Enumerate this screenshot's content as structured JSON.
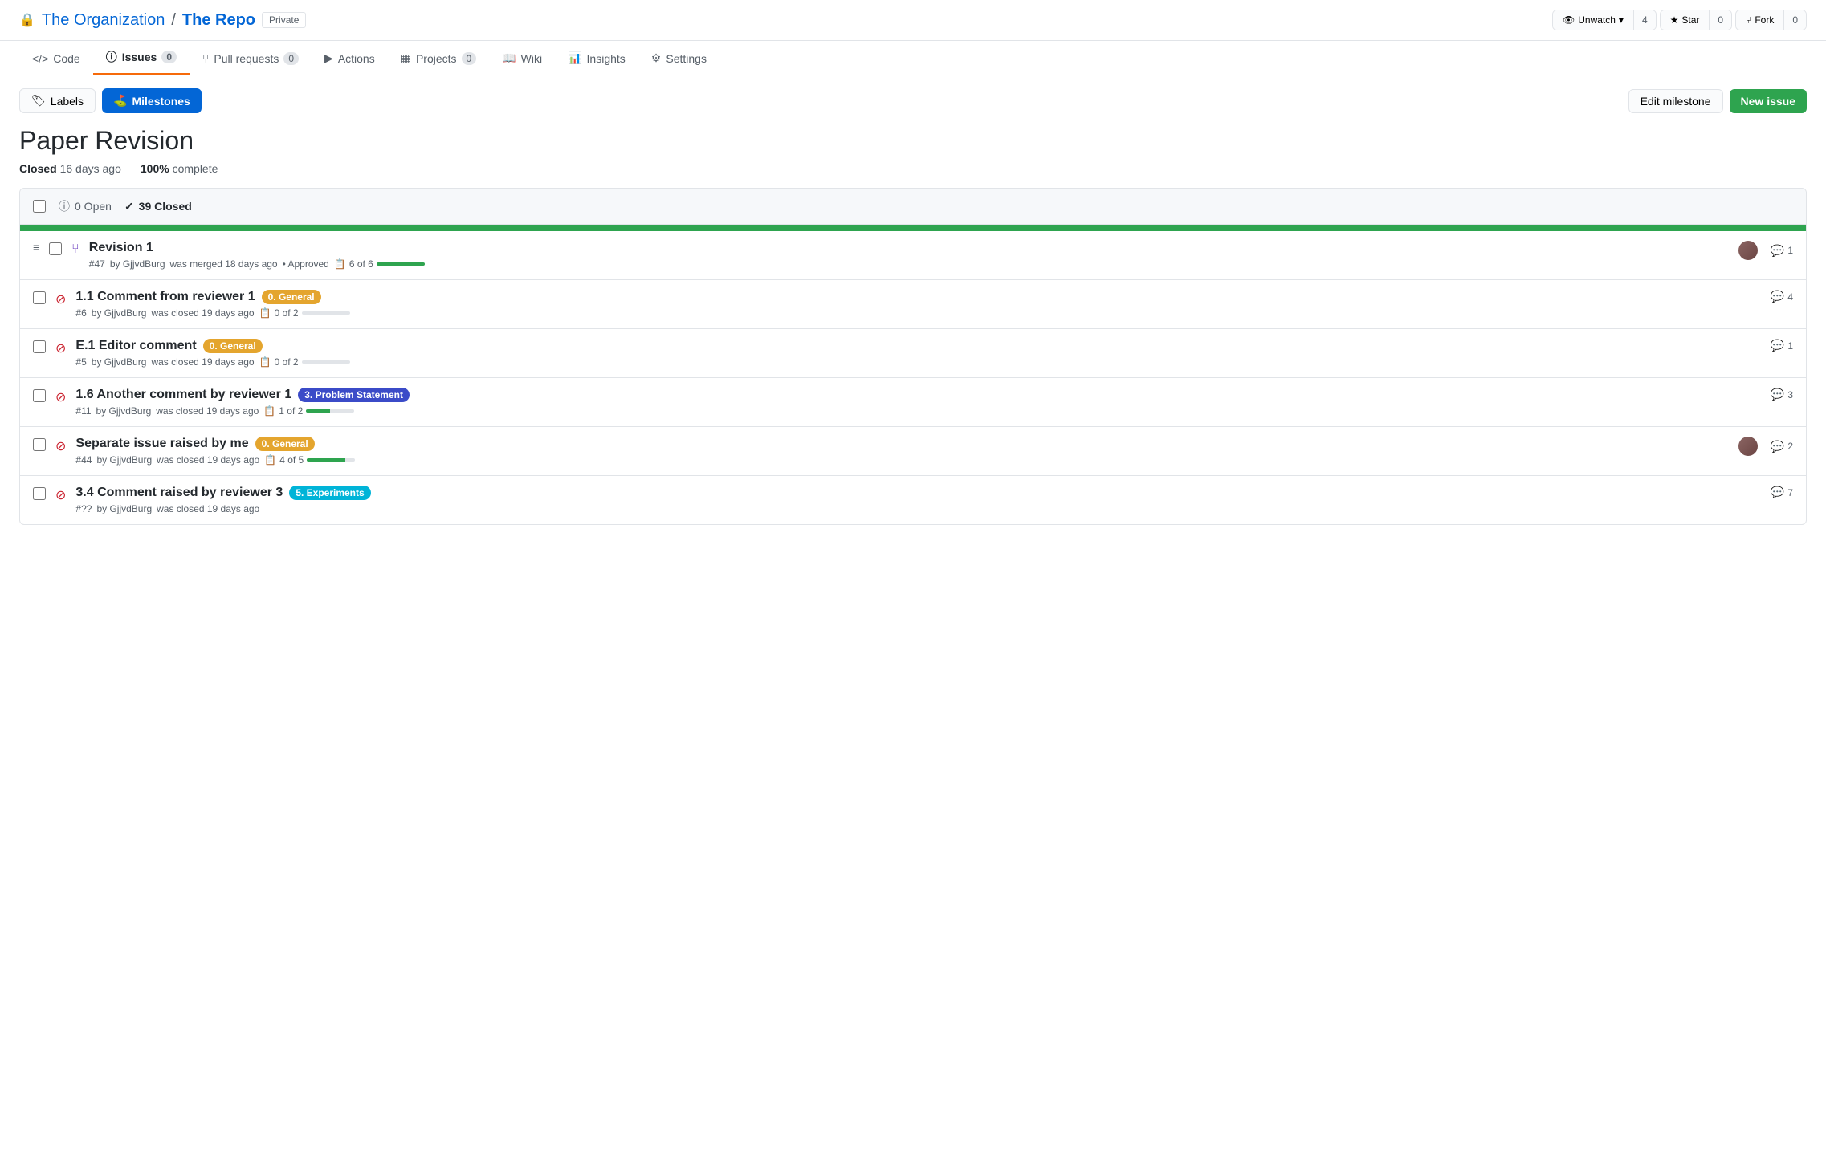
{
  "header": {
    "org_name": "The Organization",
    "separator": "/",
    "repo_name": "The Repo",
    "private_label": "Private",
    "unwatch_label": "Unwatch",
    "unwatch_count": "4",
    "star_label": "Star",
    "star_count": "0",
    "fork_label": "Fork",
    "fork_count": "0"
  },
  "nav": {
    "tabs": [
      {
        "id": "code",
        "label": "Code",
        "badge": null,
        "active": false
      },
      {
        "id": "issues",
        "label": "Issues",
        "badge": "0",
        "active": true
      },
      {
        "id": "pull-requests",
        "label": "Pull requests",
        "badge": "0",
        "active": false
      },
      {
        "id": "actions",
        "label": "Actions",
        "badge": null,
        "active": false
      },
      {
        "id": "projects",
        "label": "Projects",
        "badge": "0",
        "active": false
      },
      {
        "id": "wiki",
        "label": "Wiki",
        "badge": null,
        "active": false
      },
      {
        "id": "insights",
        "label": "Insights",
        "badge": null,
        "active": false
      },
      {
        "id": "settings",
        "label": "Settings",
        "badge": null,
        "active": false
      }
    ]
  },
  "toolbar": {
    "labels_btn": "Labels",
    "milestones_btn": "Milestones",
    "edit_milestone_btn": "Edit milestone",
    "new_issue_btn": "New issue"
  },
  "milestone": {
    "title": "Paper Revision",
    "closed_label": "Closed",
    "closed_ago": "16 days ago",
    "complete_label": "100%",
    "complete_text": "complete"
  },
  "issues_header": {
    "open_count": "0 Open",
    "closed_count": "39 Closed"
  },
  "issues": [
    {
      "type": "pr",
      "icon": "⑂",
      "title": "Revision 1",
      "number": "#47",
      "author": "GjjvdBurg",
      "action": "was merged 18 days ago",
      "extra": "• Approved",
      "task_done": 6,
      "task_total": 6,
      "task_pct": 100,
      "labels": [],
      "has_avatar": true,
      "comments": "1"
    },
    {
      "type": "issue",
      "icon": "⊘",
      "title": "1.1 Comment from reviewer 1",
      "number": "#6",
      "author": "GjjvdBurg",
      "action": "was closed 19 days ago",
      "task_done": 0,
      "task_total": 2,
      "task_pct": 0,
      "labels": [
        {
          "text": "0. General",
          "class": "label-general"
        }
      ],
      "has_avatar": false,
      "comments": "4"
    },
    {
      "type": "issue",
      "icon": "⊘",
      "title": "E.1 Editor comment",
      "number": "#5",
      "author": "GjjvdBurg",
      "action": "was closed 19 days ago",
      "task_done": 0,
      "task_total": 2,
      "task_pct": 0,
      "labels": [
        {
          "text": "0. General",
          "class": "label-general"
        }
      ],
      "has_avatar": false,
      "comments": "1"
    },
    {
      "type": "issue",
      "icon": "⊘",
      "title": "1.6 Another comment by reviewer 1",
      "number": "#11",
      "author": "GjjvdBurg",
      "action": "was closed 19 days ago",
      "task_done": 1,
      "task_total": 2,
      "task_pct": 50,
      "labels": [
        {
          "text": "3. Problem Statement",
          "class": "label-problem"
        }
      ],
      "has_avatar": false,
      "comments": "3"
    },
    {
      "type": "issue",
      "icon": "⊘",
      "title": "Separate issue raised by me",
      "number": "#44",
      "author": "GjjvdBurg",
      "action": "was closed 19 days ago",
      "task_done": 4,
      "task_total": 5,
      "task_pct": 80,
      "labels": [
        {
          "text": "0. General",
          "class": "label-general"
        }
      ],
      "has_avatar": true,
      "comments": "2"
    },
    {
      "type": "issue",
      "icon": "⊘",
      "title": "3.4 Comment raised by reviewer 3",
      "number": "#??",
      "author": "GjjvdBurg",
      "action": "was closed 19 days ago",
      "task_done": 0,
      "task_total": 0,
      "task_pct": 0,
      "labels": [
        {
          "text": "5. Experiments",
          "class": "label-experiments"
        }
      ],
      "has_avatar": false,
      "comments": "7"
    }
  ],
  "icons": {
    "lock": "🔒",
    "eye": "👁",
    "star": "★",
    "fork": "⑂",
    "code": "</>",
    "issue_open": "ⓘ",
    "issue_closed": "✓",
    "check": "✓",
    "comment": "💬",
    "task": "📋",
    "milestone_icon": "⛳",
    "label_icon": "🏷"
  }
}
